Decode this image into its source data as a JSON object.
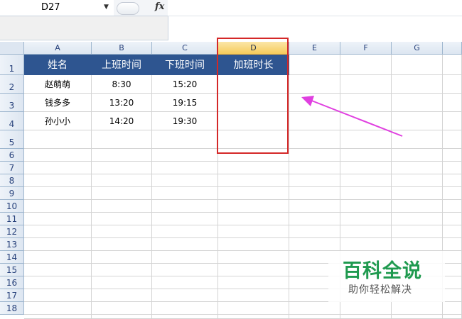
{
  "formula_bar": {
    "name_box": "D27",
    "fx_label": "fx",
    "formula": ""
  },
  "columns": [
    "A",
    "B",
    "C",
    "D",
    "E",
    "F",
    "G"
  ],
  "selected_column": "D",
  "rows": [
    "1",
    "2",
    "3",
    "4",
    "5",
    "6",
    "7",
    "8",
    "9",
    "10",
    "11",
    "12",
    "13",
    "14",
    "15",
    "16",
    "17",
    "18"
  ],
  "table": {
    "headers": [
      "姓名",
      "上班时间",
      "下班时间",
      "加班时长"
    ],
    "data": [
      [
        "赵萌萌",
        "8:30",
        "15:20",
        ""
      ],
      [
        "钱多多",
        "13:20",
        "19:15",
        ""
      ],
      [
        "孙小小",
        "14:20",
        "19:30",
        ""
      ]
    ]
  },
  "colors": {
    "header_fill": "#2e5590",
    "highlight_border": "#d42828",
    "arrow": "#e040e0",
    "watermark_green": "#1f9a4f"
  },
  "watermark": {
    "title": "百科全说",
    "subtitle": "助你轻松解决"
  }
}
